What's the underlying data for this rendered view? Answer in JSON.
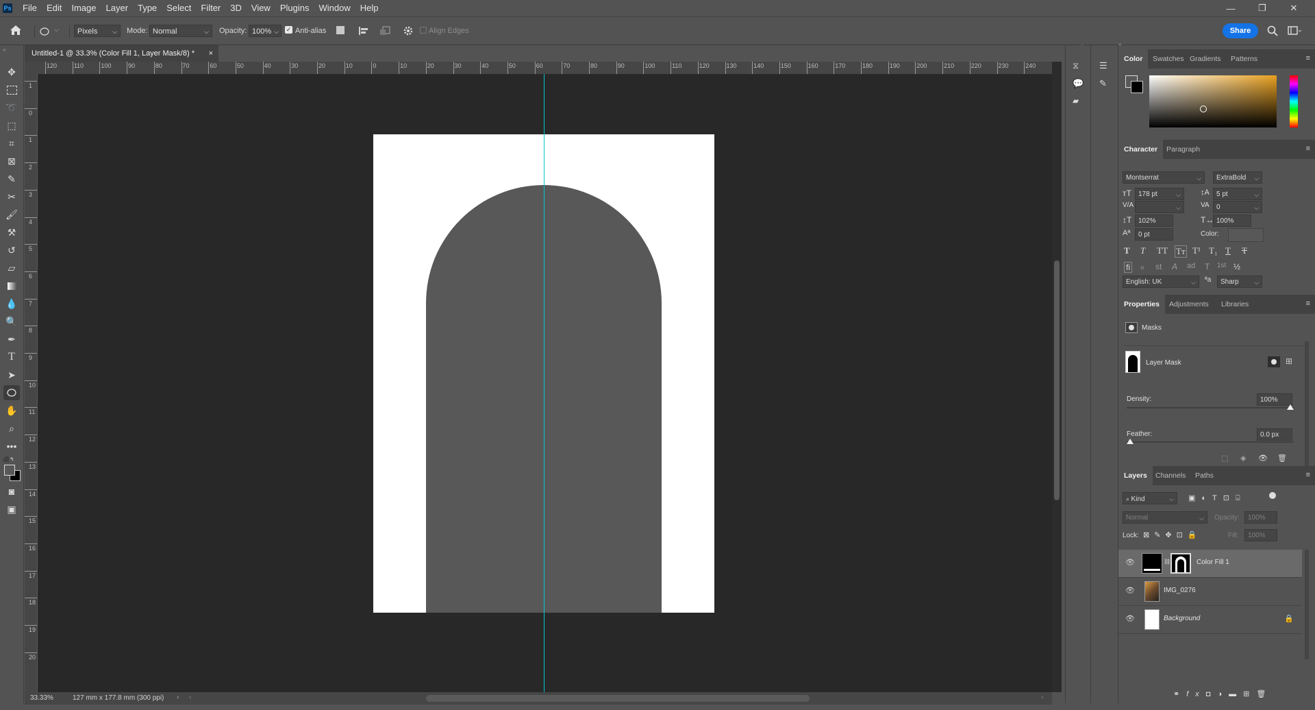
{
  "app": {
    "logo": "Ps"
  },
  "menu": [
    "File",
    "Edit",
    "Image",
    "Layer",
    "Type",
    "Select",
    "Filter",
    "3D",
    "View",
    "Plugins",
    "Window",
    "Help"
  ],
  "window_controls": {
    "minimize": "—",
    "restore": "❐",
    "close": "✕"
  },
  "options_bar": {
    "unit": "Pixels",
    "mode_label": "Mode:",
    "mode_value": "Normal",
    "opacity_label": "Opacity:",
    "opacity_value": "100%",
    "antialias_label": "Anti-alias",
    "align_edges_label": "Align Edges",
    "share_label": "Share"
  },
  "document": {
    "tab_title": "Untitled-1 @ 33.3% (Color Fill 1, Layer Mask/8) *",
    "close": "×",
    "zoom": "33.33%",
    "doc_info": "127 mm x 177.8 mm (300 ppi)"
  },
  "ruler": {
    "h_ticks": [
      "120",
      "110",
      "100",
      "90",
      "80",
      "70",
      "60",
      "50",
      "40",
      "30",
      "20",
      "10",
      "0",
      "10",
      "20",
      "30",
      "40",
      "50",
      "60",
      "70",
      "80",
      "90",
      "100",
      "110",
      "120",
      "130",
      "140",
      "150",
      "160",
      "170",
      "180",
      "190",
      "200",
      "210",
      "220",
      "230",
      "240"
    ],
    "v_ticks": [
      "1",
      "0",
      "1",
      "2",
      "3",
      "4",
      "5",
      "6",
      "7",
      "8",
      "9",
      "10",
      "11",
      "12",
      "13",
      "14",
      "15",
      "16",
      "17",
      "18",
      "19",
      "20"
    ]
  },
  "color_panel": {
    "tabs": [
      "Color",
      "Swatches",
      "Gradients",
      "Patterns"
    ],
    "active_tab": "Color",
    "hue_color": "#e8a020"
  },
  "character_panel": {
    "tabs": [
      "Character",
      "Paragraph"
    ],
    "font_family": "Montserrat",
    "font_style": "ExtraBold",
    "font_size": "178 pt",
    "leading": "5 pt",
    "kerning": "",
    "tracking": "0",
    "vertical_scale": "102%",
    "horizontal_scale": "100%",
    "baseline_shift": "0 pt",
    "color_label": "Color:",
    "type_styles": [
      "T",
      "T",
      "TT",
      "Tт",
      "T¹",
      "T₁",
      "T",
      "T"
    ],
    "opentype": [
      "fi",
      "ℴ",
      "st",
      "A",
      "ad",
      "T",
      "1st",
      "½"
    ],
    "language": "English: UK",
    "aa_label": "ªa",
    "antialias": "Sharp"
  },
  "properties_panel": {
    "tabs": [
      "Properties",
      "Adjustments",
      "Libraries"
    ],
    "masks_label": "Masks",
    "layer_mask_label": "Layer Mask",
    "density_label": "Density:",
    "density_value": "100%",
    "density_level": 1.0,
    "feather_label": "Feather:",
    "feather_value": "0.0 px",
    "feather_level": 0.0
  },
  "layers_panel": {
    "tabs": [
      "Layers",
      "Channels",
      "Paths"
    ],
    "filter_kind": "Kind",
    "blend_mode": "Normal",
    "opacity_label": "Opacity:",
    "opacity_value": "100%",
    "lock_label": "Lock:",
    "fill_label": "Fill:",
    "fill_value": "100%",
    "layers": [
      {
        "name": "Color Fill 1",
        "selected": true
      },
      {
        "name": "IMG_0276",
        "selected": false
      },
      {
        "name": "Background",
        "selected": false,
        "locked": true
      }
    ],
    "bottom_icons": [
      "link-icon",
      "fx-icon",
      "mask-icon",
      "adjustment-icon",
      "folder-icon",
      "new-layer-icon",
      "trash-icon"
    ]
  },
  "colors": {
    "accent": "#1473e6",
    "guide": "#00c8d2",
    "canvas_bg": "#282828",
    "document_white": "#ffffff",
    "arch_fill": "#585858"
  }
}
